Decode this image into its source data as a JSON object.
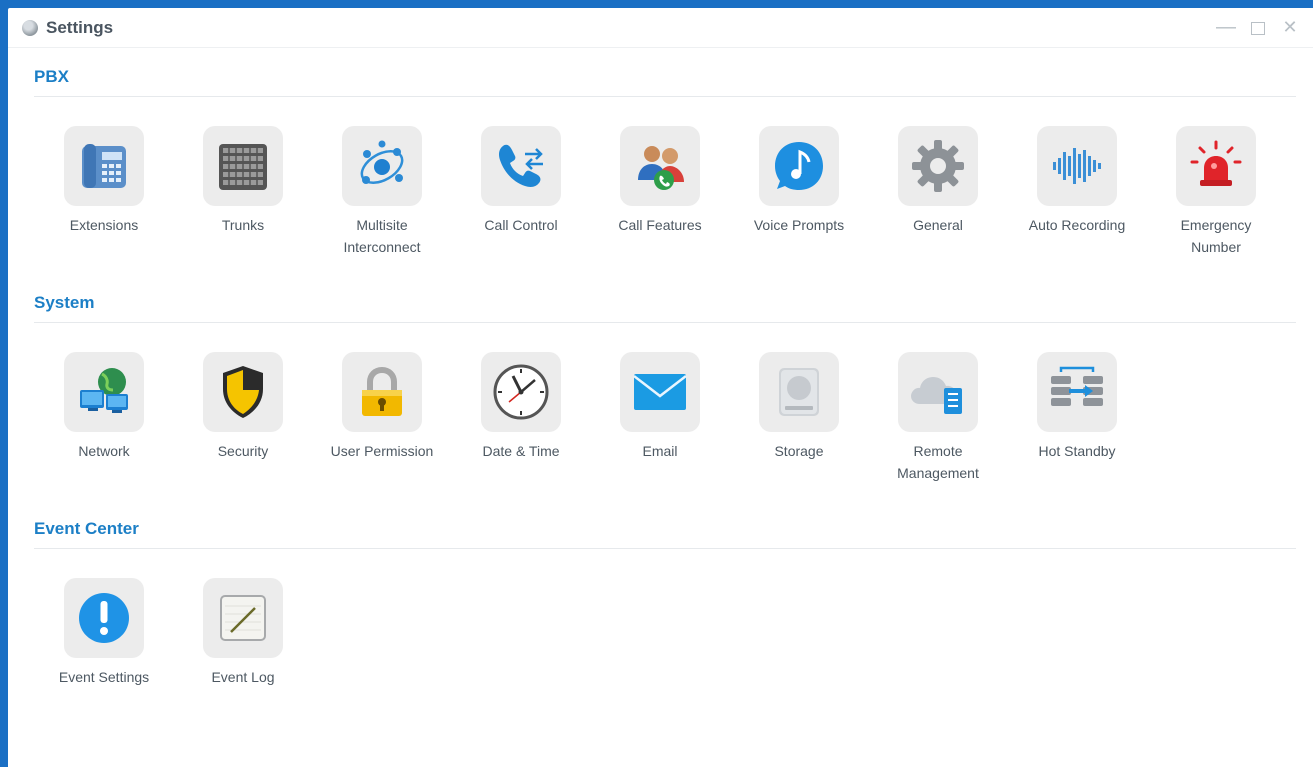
{
  "window": {
    "title": "Settings",
    "controls": {
      "minimize": "—",
      "close": "✕"
    }
  },
  "sections": {
    "pbx": {
      "title": "PBX",
      "items": [
        {
          "label": "Extensions",
          "icon": "desk-phone-icon"
        },
        {
          "label": "Trunks",
          "icon": "trunk-grid-icon"
        },
        {
          "label": "Multisite\nInterconnect",
          "icon": "multisite-network-icon"
        },
        {
          "label": "Call Control",
          "icon": "phone-arrows-icon"
        },
        {
          "label": "Call Features",
          "icon": "users-phone-icon"
        },
        {
          "label": "Voice Prompts",
          "icon": "music-bubble-icon"
        },
        {
          "label": "General",
          "icon": "gear-icon"
        },
        {
          "label": "Auto Recording",
          "icon": "waveform-icon"
        },
        {
          "label": "Emergency\nNumber",
          "icon": "siren-icon"
        }
      ]
    },
    "system": {
      "title": "System",
      "items": [
        {
          "label": "Network",
          "icon": "globe-network-icon"
        },
        {
          "label": "Security",
          "icon": "shield-icon"
        },
        {
          "label": "User Permission",
          "icon": "padlock-icon"
        },
        {
          "label": "Date & Time",
          "icon": "clock-icon"
        },
        {
          "label": "Email",
          "icon": "envelope-icon"
        },
        {
          "label": "Storage",
          "icon": "hard-drive-icon"
        },
        {
          "label": "Remote\nManagement",
          "icon": "cloud-server-icon"
        },
        {
          "label": "Hot Standby",
          "icon": "server-sync-icon"
        }
      ]
    },
    "event_center": {
      "title": "Event Center",
      "items": [
        {
          "label": "Event Settings",
          "icon": "alert-circle-icon"
        },
        {
          "label": "Event Log",
          "icon": "notepad-pen-icon"
        }
      ]
    }
  },
  "colors": {
    "accent": "#1c7fc6",
    "desktop": "#1a6fc4",
    "tile": "#ececec",
    "label": "#4d5862"
  }
}
